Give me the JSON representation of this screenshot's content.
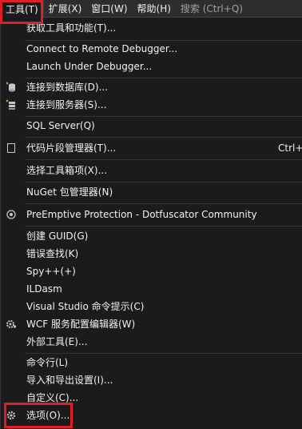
{
  "menubar": {
    "items": [
      {
        "label": "工具(T)"
      },
      {
        "label": "扩展(X)"
      },
      {
        "label": "窗口(W)"
      },
      {
        "label": "帮助(H)"
      }
    ],
    "search_label": "搜索 (Ctrl+Q)"
  },
  "menu": {
    "items": [
      {
        "label": "获取工具和功能(T)..."
      },
      {
        "label": "Connect to Remote Debugger..."
      },
      {
        "label": "Launch Under Debugger..."
      },
      {
        "label": "连接到数据库(D)...",
        "icon": "database-connect-icon"
      },
      {
        "label": "连接到服务器(S)...",
        "icon": "server-connect-icon"
      },
      {
        "label": "SQL Server(Q)"
      },
      {
        "label": "代码片段管理器(T)...",
        "icon": "snippet-icon",
        "shortcut": "Ctrl+"
      },
      {
        "label": "选择工具箱项(X)..."
      },
      {
        "label": "NuGet 包管理器(N)"
      },
      {
        "label": "PreEmptive Protection - Dotfuscator Community",
        "icon": "dotfuscator-icon"
      },
      {
        "label": "创建 GUID(G)"
      },
      {
        "label": "错误查找(K)"
      },
      {
        "label": "Spy++(+)"
      },
      {
        "label": "ILDasm"
      },
      {
        "label": "Visual Studio 命令提示(C)"
      },
      {
        "label": "WCF 服务配置编辑器(W)",
        "icon": "wcf-config-icon"
      },
      {
        "label": "外部工具(E)..."
      },
      {
        "label": "命令行(L)"
      },
      {
        "label": "导入和导出设置(I)..."
      },
      {
        "label": "自定义(C)..."
      },
      {
        "label": "选项(O)...",
        "icon": "options-gear-icon"
      }
    ]
  },
  "colors": {
    "background": "#1b1b1c",
    "menubar": "#2d2d30",
    "text": "#f1f1f1",
    "highlight": "#e01e25"
  }
}
